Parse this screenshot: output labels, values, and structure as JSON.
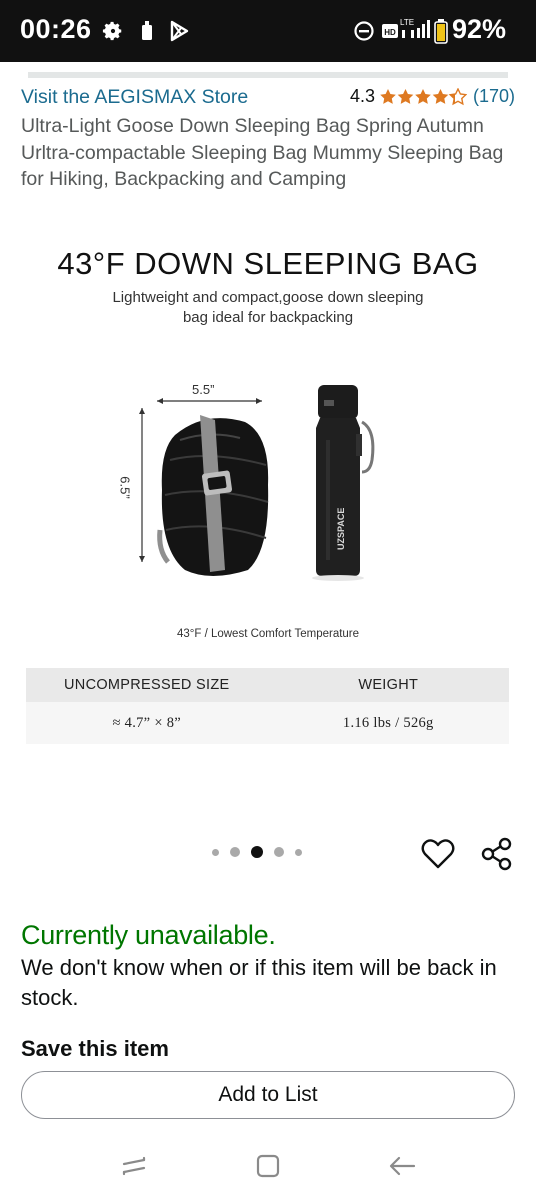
{
  "status_bar": {
    "time": "00:26",
    "battery_percent": "92%",
    "network_label": "LTE"
  },
  "product": {
    "store_link": "Visit the AEGISMAX Store",
    "rating_value": "4.3",
    "rating_stars": 4.3,
    "rating_count": "(170)",
    "title": "Ultra-Light Goose Down Sleeping Bag Spring Autumn Urltra-compactable Sleeping Bag Mummy Sleeping Bag for Hiking, Backpacking and Camping"
  },
  "image": {
    "headline": "43°F DOWN SLEEPING BAG",
    "subtitle_line1": "Lightweight and compact,goose down sleeping",
    "subtitle_line2": "bag ideal for backpacking",
    "width_label": "5.5”",
    "height_label": "6.5”",
    "bottle_brand": "UZSPACE",
    "comfort_note": "43°F /  Lowest Comfort Temperature",
    "spec_headers": [
      "UNCOMPRESSED SIZE",
      "WEIGHT"
    ],
    "spec_values": [
      "≈ 4.7”  × 8”",
      "1.16 lbs  /  526g"
    ]
  },
  "carousel": {
    "total": 5,
    "active_index": 2
  },
  "availability": {
    "status": "Currently unavailable.",
    "message": "We don't know when or if this item will be back in stock."
  },
  "save": {
    "heading": "Save this item",
    "add_to_list_label": "Add to List"
  },
  "colors": {
    "link": "#1b6b8f",
    "star": "#de7921",
    "available_green": "#007600"
  },
  "icons": [
    "settings-icon",
    "sim-icon",
    "play-store-icon",
    "dnd-icon",
    "hd-icon",
    "signal-icon",
    "battery-icon",
    "heart-icon",
    "share-icon",
    "recents-icon",
    "home-icon",
    "back-icon"
  ]
}
